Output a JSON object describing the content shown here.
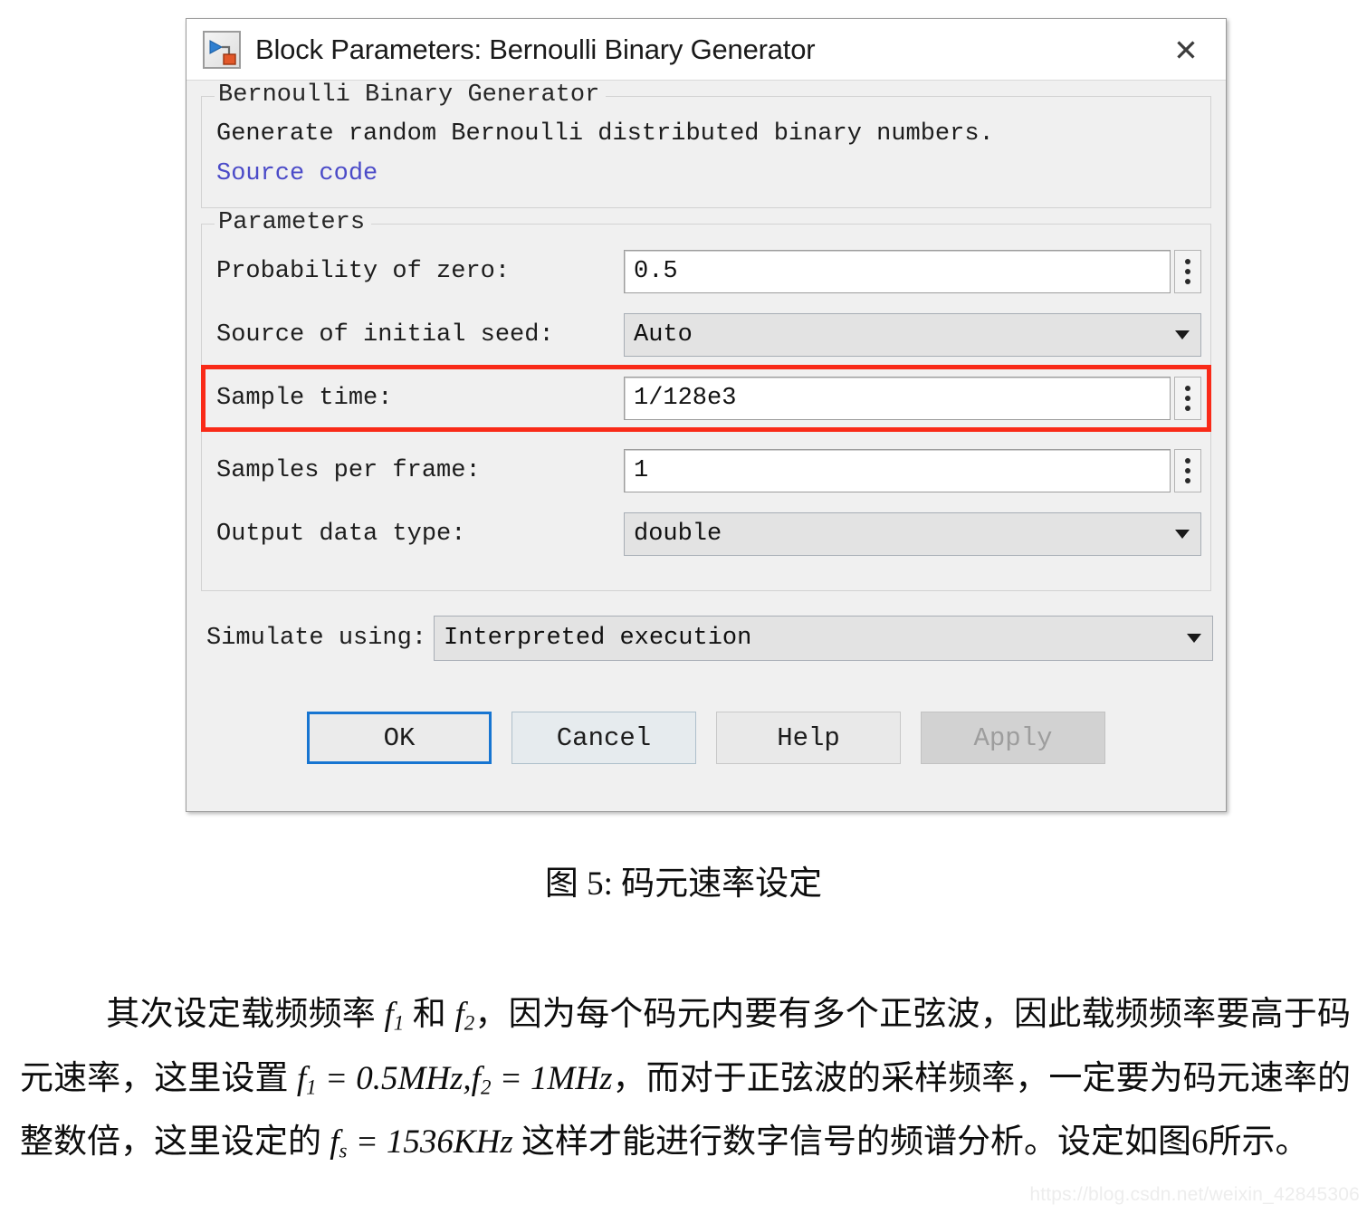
{
  "dialog": {
    "title": "Block Parameters: Bernoulli Binary Generator",
    "icon": "simulink-block-icon",
    "close_label": "✕",
    "description_group": {
      "legend": "Bernoulli Binary Generator",
      "text": "Generate random Bernoulli distributed binary numbers.",
      "link": "Source code"
    },
    "parameters_group": {
      "legend": "Parameters",
      "rows": [
        {
          "label": "Probability of zero:",
          "value": "0.5",
          "control": "textfield-with-spinner",
          "highlighted": false
        },
        {
          "label": "Source of initial seed:",
          "value": "Auto",
          "control": "dropdown",
          "highlighted": false
        },
        {
          "label": "Sample time:",
          "value": "1/128e3",
          "control": "textfield-with-spinner",
          "highlighted": true
        },
        {
          "label": "Samples per frame:",
          "value": "1",
          "control": "textfield-with-spinner",
          "highlighted": false
        },
        {
          "label": "Output data type:",
          "value": "double",
          "control": "dropdown",
          "highlighted": false
        }
      ]
    },
    "simulate_using": {
      "label": "Simulate using:",
      "value": "Interpreted execution"
    },
    "buttons": [
      {
        "label": "OK",
        "state": "default"
      },
      {
        "label": "Cancel",
        "state": "normal"
      },
      {
        "label": "Help",
        "state": "normal"
      },
      {
        "label": "Apply",
        "state": "disabled"
      }
    ]
  },
  "figure_caption": "图 5: 码元速率设定",
  "body_text": {
    "part1": "其次设定载频频率 ",
    "f1": "f",
    "f1_sub": "1",
    "part2": " 和 ",
    "f2": "f",
    "f2_sub": "2",
    "part3": "，因为每个码元内要有多个正弦波，因此载频频率要高于码元速率，这里设置 ",
    "eq1": "f",
    "eq1_sub": "1",
    "eq1_rest": " = 0.5MHz,",
    "eq2": "f",
    "eq2_sub": "2",
    "eq2_rest": " = 1MHz",
    "part4": "，而对于正弦波的采样频率，一定要为码元速率的整数倍，这里设定的 ",
    "eq3": "f",
    "eq3_sub": "s",
    "eq3_rest": " = 1536KHz",
    "part5": " 这样才能进行数字信号的频谱分析。设定如图6所示。"
  },
  "watermark": "https://blog.csdn.net/weixin_42845306",
  "colors": {
    "highlight_red": "#f92a18",
    "link_blue": "#4b4bc8",
    "default_button_border": "#1775d1",
    "dialog_bg": "#f0f0f0"
  }
}
